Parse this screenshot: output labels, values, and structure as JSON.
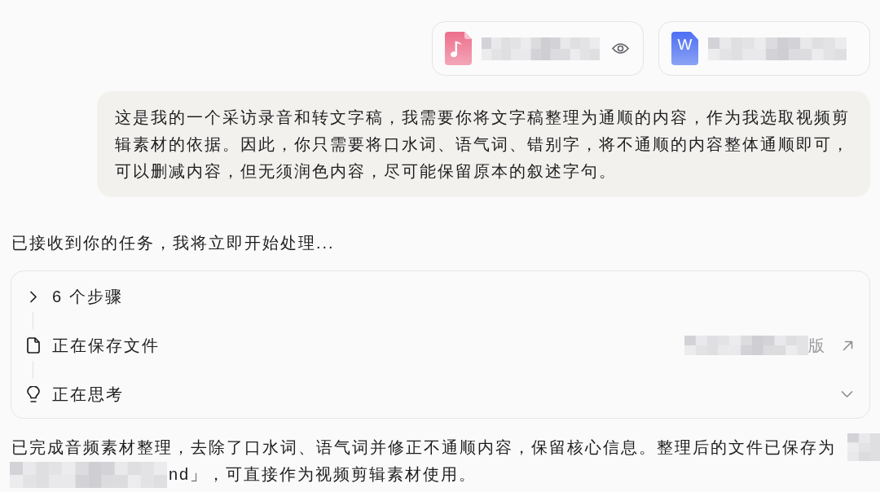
{
  "attachments": [
    {
      "kind": "audio",
      "previewable": true
    },
    {
      "kind": "word",
      "icon_letter": "W",
      "previewable": false
    }
  ],
  "user_message": "这是我的一个采访录音和转文字稿，我需要你将文字稿整理为通顺的内容，作为我选取视频剪辑素材的依据。因此，你只需要将口水词、语气词、错别字，将不通顺的内容整体通顺即可，可以删减内容，但无须润色内容，尽可能保留原本的叙述字句。",
  "assistant": {
    "acknowledgement": "已接收到你的任务，我将立即开始处理...",
    "steps": [
      {
        "kind": "summary",
        "label": "6 个步骤",
        "expanded": false
      },
      {
        "kind": "file",
        "label": "正在保存文件",
        "file_name_tail": "版"
      },
      {
        "kind": "thinking",
        "label": "正在思考",
        "expanded": false
      }
    ],
    "result_lines": [
      "已完成音频素材整理，去除了口水词、语气词并修正不通顺内容，保留核心信息。整理后的文件已保存为",
      "nd」，可直接作为视频剪辑素材使用。"
    ]
  }
}
